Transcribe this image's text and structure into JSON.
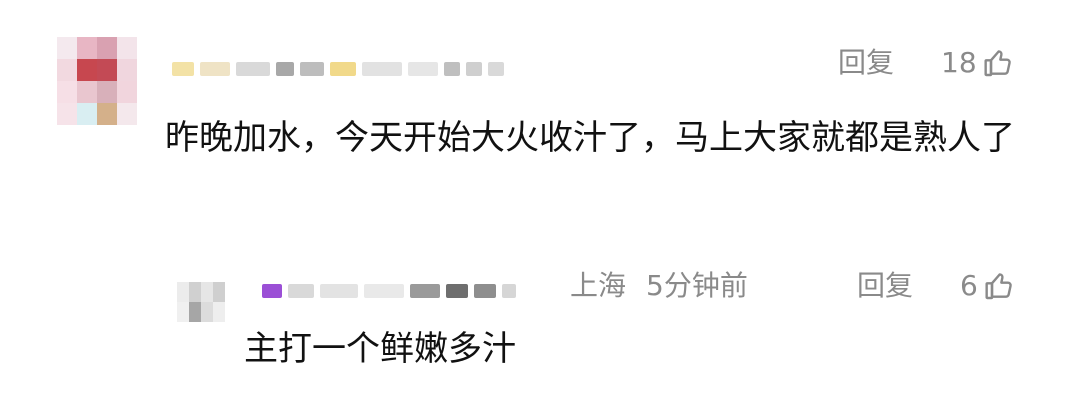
{
  "comment": {
    "text": "昨晚加水，今天开始大火收汁了，马上大家就都是熟人了",
    "reply_label": "回复",
    "like_count": "18"
  },
  "reply": {
    "location": "上海",
    "time": "5分钟前",
    "text": "主打一个鲜嫩多汁",
    "reply_label": "回复",
    "like_count": "6"
  },
  "icons": {
    "like": "thumbs-up-icon"
  },
  "colors": {
    "meta_gray": "#8a8a8a",
    "text": "#111111"
  }
}
